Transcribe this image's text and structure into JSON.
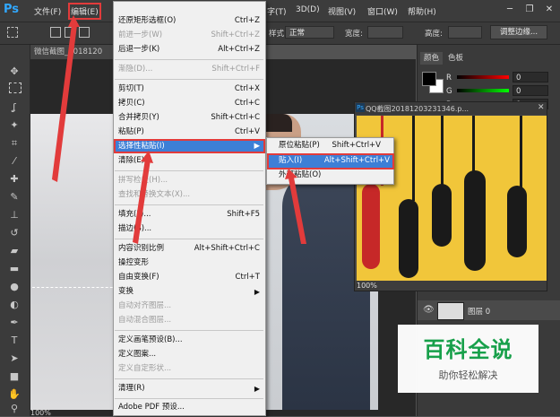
{
  "app": {
    "logo": "Ps"
  },
  "menubar": {
    "file": "文件(F)",
    "edit": "编辑(E)",
    "type": "字(T)",
    "threeD": "3D(D)",
    "view": "视图(V)",
    "window": "窗口(W)",
    "help": "帮助(H)",
    "min": "─",
    "restore": "❐",
    "close": "✕"
  },
  "options": {
    "style_label": "样式:",
    "style_value": "正常",
    "width_label": "宽度:",
    "height_label": "高度:",
    "refine_button": "调整边缘..."
  },
  "document": {
    "tab": "微信截图_2018120"
  },
  "edit_menu": {
    "items": [
      {
        "label": "还原矩形选框(O)",
        "shortcut": "Ctrl+Z",
        "enabled": true
      },
      {
        "label": "前进一步(W)",
        "shortcut": "Shift+Ctrl+Z",
        "enabled": false
      },
      {
        "label": "后退一步(K)",
        "shortcut": "Alt+Ctrl+Z",
        "enabled": true
      },
      {
        "label": "渐隐(D)...",
        "shortcut": "Shift+Ctrl+F",
        "enabled": false
      },
      {
        "label": "剪切(T)",
        "shortcut": "Ctrl+X",
        "enabled": true
      },
      {
        "label": "拷贝(C)",
        "shortcut": "Ctrl+C",
        "enabled": true
      },
      {
        "label": "合并拷贝(Y)",
        "shortcut": "Shift+Ctrl+C",
        "enabled": true
      },
      {
        "label": "粘贴(P)",
        "shortcut": "Ctrl+V",
        "enabled": true
      },
      {
        "label": "选择性粘贴(I)",
        "shortcut": "",
        "enabled": true
      },
      {
        "label": "清除(E)",
        "shortcut": "",
        "enabled": true
      },
      {
        "label": "拼写检查(H)...",
        "shortcut": "",
        "enabled": false
      },
      {
        "label": "查找和替换文本(X)...",
        "shortcut": "",
        "enabled": false
      },
      {
        "label": "填充(L)...",
        "shortcut": "Shift+F5",
        "enabled": true
      },
      {
        "label": "描边(S)...",
        "shortcut": "",
        "enabled": true
      },
      {
        "label": "内容识别比例",
        "shortcut": "Alt+Shift+Ctrl+C",
        "enabled": true
      },
      {
        "label": "操控变形",
        "shortcut": "",
        "enabled": true
      },
      {
        "label": "自由变换(F)",
        "shortcut": "Ctrl+T",
        "enabled": true
      },
      {
        "label": "变换",
        "shortcut": "",
        "enabled": true
      },
      {
        "label": "自动对齐图层...",
        "shortcut": "",
        "enabled": false
      },
      {
        "label": "自动混合图层...",
        "shortcut": "",
        "enabled": false
      },
      {
        "label": "定义画笔预设(B)...",
        "shortcut": "",
        "enabled": true
      },
      {
        "label": "定义图案...",
        "shortcut": "",
        "enabled": true
      },
      {
        "label": "定义自定形状...",
        "shortcut": "",
        "enabled": false
      },
      {
        "label": "清理(R)",
        "shortcut": "",
        "enabled": true
      },
      {
        "label": "Adobe PDF 预设...",
        "shortcut": "",
        "enabled": true
      }
    ]
  },
  "paste_special": {
    "items": [
      {
        "label": "原位粘贴(P)",
        "shortcut": "Shift+Ctrl+V"
      },
      {
        "label": "贴入(I)",
        "shortcut": "Alt+Shift+Ctrl+V"
      },
      {
        "label": "外部粘贴(O)",
        "shortcut": ""
      }
    ]
  },
  "panel": {
    "tab_color": "颜色",
    "tab_swatches": "色板",
    "r_label": "R",
    "g_label": "G",
    "b_label": "B",
    "r_value": "0",
    "g_value": "0",
    "b_value": "0",
    "layer_name": "图层 0"
  },
  "float_window": {
    "title": "QQ截图20181203231346.p...",
    "zoom": "100%"
  },
  "watermark": {
    "title": "百科全说",
    "subtitle": "助你轻松解决"
  },
  "status": {
    "zoom": "100%"
  },
  "colors": {
    "accent_red": "#e23b3b",
    "menu_highlight": "#3d7fd6",
    "watermark_green": "#17a04a"
  }
}
